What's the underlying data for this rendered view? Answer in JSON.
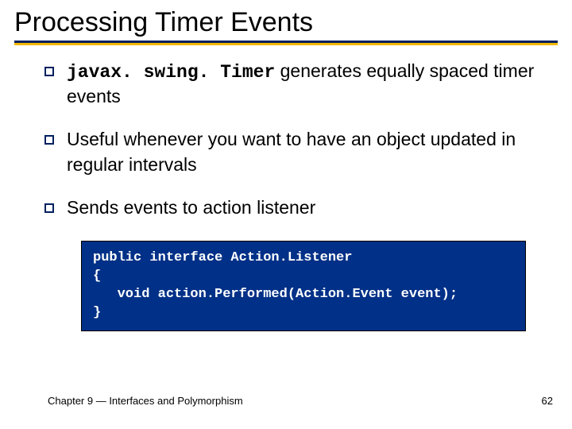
{
  "title": "Processing Timer Events",
  "bullets": [
    {
      "code": "javax. swing. Timer",
      "rest": " generates equally spaced timer events"
    },
    {
      "code": "",
      "rest": "Useful whenever you want to have an object updated in regular intervals"
    },
    {
      "code": "",
      "rest": "Sends events to action listener"
    }
  ],
  "code": {
    "l1": "public interface Action.Listener",
    "l2": "{",
    "l3": "   void action.Performed(Action.Event event);",
    "l4": "}"
  },
  "footer": {
    "left_pre": "Chapter 9 ",
    "left_dash": "—",
    "left_post": " Interfaces and Polymorphism",
    "page": "62"
  }
}
